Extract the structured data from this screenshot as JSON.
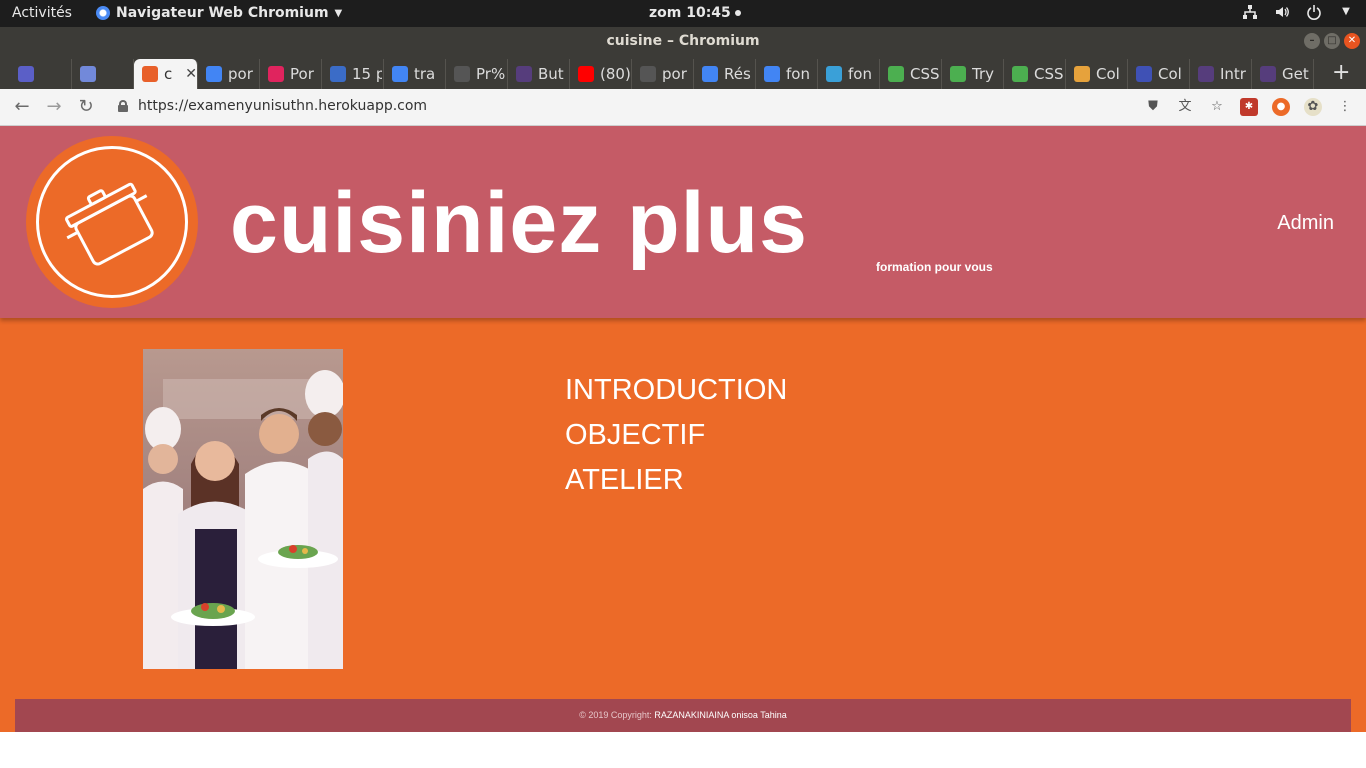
{
  "desktop": {
    "activities": "Activités",
    "app_menu": "Navigateur Web Chromium",
    "clock": "zom 10:45"
  },
  "window": {
    "title": "cuisine – Chromium"
  },
  "tabs": [
    {
      "label": "",
      "icon": "tab-favicon",
      "color": "#5b5fc7"
    },
    {
      "label": "",
      "icon": "discord-icon",
      "color": "#7289da"
    },
    {
      "label": "c",
      "icon": "pan-favicon",
      "color": "#e8602a",
      "active": true
    },
    {
      "label": "por",
      "icon": "google-icon",
      "color": "#4285f4"
    },
    {
      "label": "Por",
      "icon": "heart-icon",
      "color": "#e0245e"
    },
    {
      "label": "15 p",
      "icon": "globe-icon",
      "color": "#3b6cc7"
    },
    {
      "label": "tra",
      "icon": "google-icon",
      "color": "#4285f4"
    },
    {
      "label": "Pr%",
      "icon": "globe-icon",
      "color": "#555555"
    },
    {
      "label": "But",
      "icon": "bootstrap-icon",
      "color": "#563d7c"
    },
    {
      "label": "(80)",
      "icon": "youtube-icon",
      "color": "#ff0000"
    },
    {
      "label": "por",
      "icon": "globe-icon",
      "color": "#555555"
    },
    {
      "label": "Rés",
      "icon": "google-icon",
      "color": "#4285f4"
    },
    {
      "label": "fon",
      "icon": "google-icon",
      "color": "#4285f4"
    },
    {
      "label": "fon",
      "icon": "fonts-icon",
      "color": "#3aa0d8"
    },
    {
      "label": "CSS",
      "icon": "w3schools-icon",
      "color": "#4caf50"
    },
    {
      "label": "Try",
      "icon": "w3schools-icon",
      "color": "#4caf50"
    },
    {
      "label": "CSS",
      "icon": "w3schools-icon",
      "color": "#4caf50"
    },
    {
      "label": "Col",
      "icon": "colors-icon",
      "color": "#e6a23c"
    },
    {
      "label": "Col",
      "icon": "circle-c-icon",
      "color": "#3f51b5"
    },
    {
      "label": "Intr",
      "icon": "bootstrap-icon",
      "color": "#563d7c"
    },
    {
      "label": "Get",
      "icon": "bootstrap-icon",
      "color": "#563d7c"
    }
  ],
  "toolbar": {
    "url": "https://examenyunisuthn.herokuapp.com"
  },
  "site": {
    "brand": "cuisiniez plus",
    "tagline": "formation pour vous",
    "admin_link": "Admin",
    "menu": [
      "INTRODUCTION",
      "OBJECTIF",
      "ATELIER"
    ],
    "footer_prefix": "© 2019 Copyright:",
    "footer_author": "RAZANAKINIAINA onisoa Tahina"
  },
  "colors": {
    "header": "#c55b66",
    "body": "#ec6a28",
    "footer": "#a24750"
  }
}
